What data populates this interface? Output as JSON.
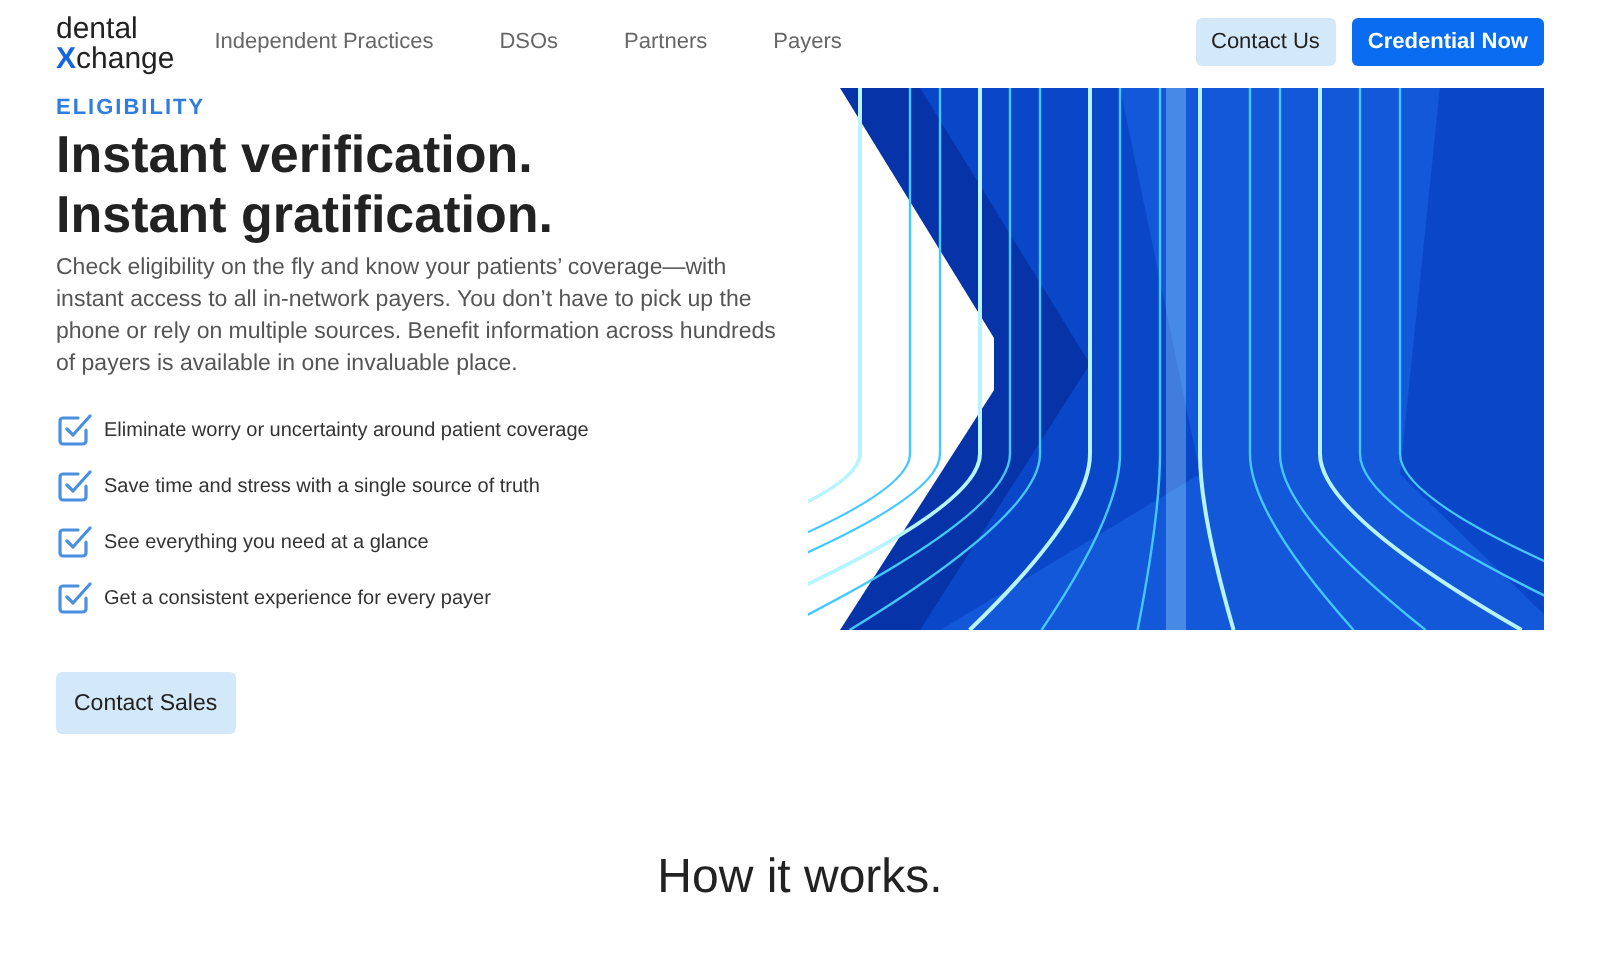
{
  "logo": {
    "top": "dental",
    "accent": "X",
    "rest": "change"
  },
  "nav": [
    {
      "label": "Independent Practices"
    },
    {
      "label": "DSOs"
    },
    {
      "label": "Partners"
    },
    {
      "label": "Payers"
    }
  ],
  "header_buttons": [
    {
      "label": "Contact Us",
      "kind": "secondary"
    },
    {
      "label": "Credential Now",
      "kind": "primary"
    }
  ],
  "hero": {
    "eyebrow": "ELIGIBILITY",
    "title_lines": [
      "Instant verification.",
      "Instant gratification."
    ],
    "body": "Check eligibility on the fly and know your patients’ coverage—with instant access to all in-network payers. You don’t have to pick up the phone or rely on multiple sources. Benefit information across hundreds of payers is available in one invaluable place.",
    "checklist": [
      {
        "text": "Eliminate worry or uncertainty around patient coverage",
        "checked": true
      },
      {
        "text": "Save time and stress with a single source of truth",
        "checked": true
      },
      {
        "text": "See everything you need at a glance",
        "checked": true
      },
      {
        "text": "Get a consistent experience for every payer",
        "checked": true
      }
    ],
    "cta": "Contact Sales"
  },
  "next_section": {
    "title": "How it works."
  }
}
